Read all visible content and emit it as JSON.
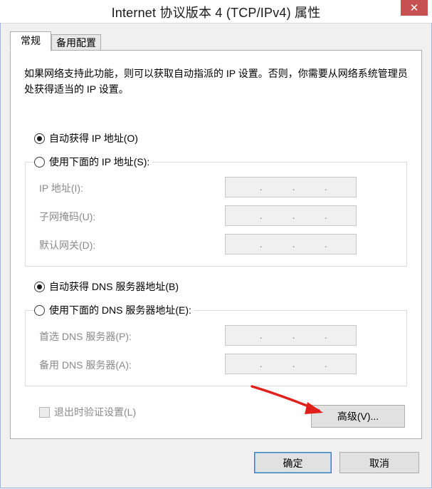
{
  "window": {
    "title": "Internet 协议版本 4 (TCP/IPv4) 属性",
    "close_symbol": "✕"
  },
  "tabs": [
    {
      "label": "常规",
      "active": true
    },
    {
      "label": "备用配置",
      "active": false
    }
  ],
  "description": "如果网络支持此功能，则可以获取自动指派的 IP 设置。否则，你需要从网络系统管理员处获得适当的 IP 设置。",
  "ip_section": {
    "auto_option": {
      "label": "自动获得 IP 地址(O)",
      "checked": true
    },
    "manual_option": {
      "label": "使用下面的 IP 地址(S):",
      "checked": false
    },
    "fields": [
      {
        "label": "IP 地址(I):",
        "value": ". . ."
      },
      {
        "label": "子网掩码(U):",
        "value": ". . ."
      },
      {
        "label": "默认网关(D):",
        "value": ". . ."
      }
    ]
  },
  "dns_section": {
    "auto_option": {
      "label": "自动获得 DNS 服务器地址(B)",
      "checked": true
    },
    "manual_option": {
      "label": "使用下面的 DNS 服务器地址(E):",
      "checked": false
    },
    "fields": [
      {
        "label": "首选 DNS 服务器(P):",
        "value": ". . ."
      },
      {
        "label": "备用 DNS 服务器(A):",
        "value": ". . ."
      }
    ]
  },
  "validate_checkbox": {
    "label": "退出时验证设置(L)",
    "checked": false,
    "enabled": false
  },
  "buttons": {
    "advanced": "高级(V)...",
    "ok": "确定",
    "cancel": "取消"
  },
  "annotation": {
    "type": "red-arrow-icon",
    "color": "#e0201b",
    "points_to": "advanced"
  },
  "colors": {
    "close_button": "#c75050",
    "window_border": "#9bb6d6",
    "default_button_border": "#3c7fb1",
    "disabled_text": "#8a8a8a"
  }
}
